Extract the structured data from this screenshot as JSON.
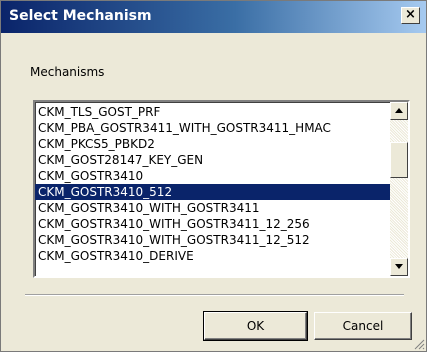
{
  "window": {
    "title": "Select Mechanism",
    "close_label": "×"
  },
  "group": {
    "label": "Mechanisms"
  },
  "mechanisms": {
    "items": [
      "CKM_TLS_GOST_PRF",
      "CKM_PBA_GOSTR3411_WITH_GOSTR3411_HMAC",
      "CKM_PKCS5_PBKD2",
      "CKM_GOST28147_KEY_GEN",
      "CKM_GOSTR3410",
      "CKM_GOSTR3410_512",
      "CKM_GOSTR3410_WITH_GOSTR3411",
      "CKM_GOSTR3410_WITH_GOSTR3411_12_256",
      "CKM_GOSTR3410_WITH_GOSTR3411_12_512",
      "CKM_GOSTR3410_DERIVE"
    ],
    "selected": "CKM_GOSTR3410_512"
  },
  "buttons": {
    "ok_label": "OK",
    "cancel_label": "Cancel"
  },
  "icons": {
    "close": "close-icon",
    "scroll_up": "arrow-up-icon",
    "scroll_down": "arrow-down-icon",
    "resize": "resize-grip-icon"
  },
  "colors": {
    "selection": "#0a246a",
    "dialog_bg": "#ece9d8"
  }
}
